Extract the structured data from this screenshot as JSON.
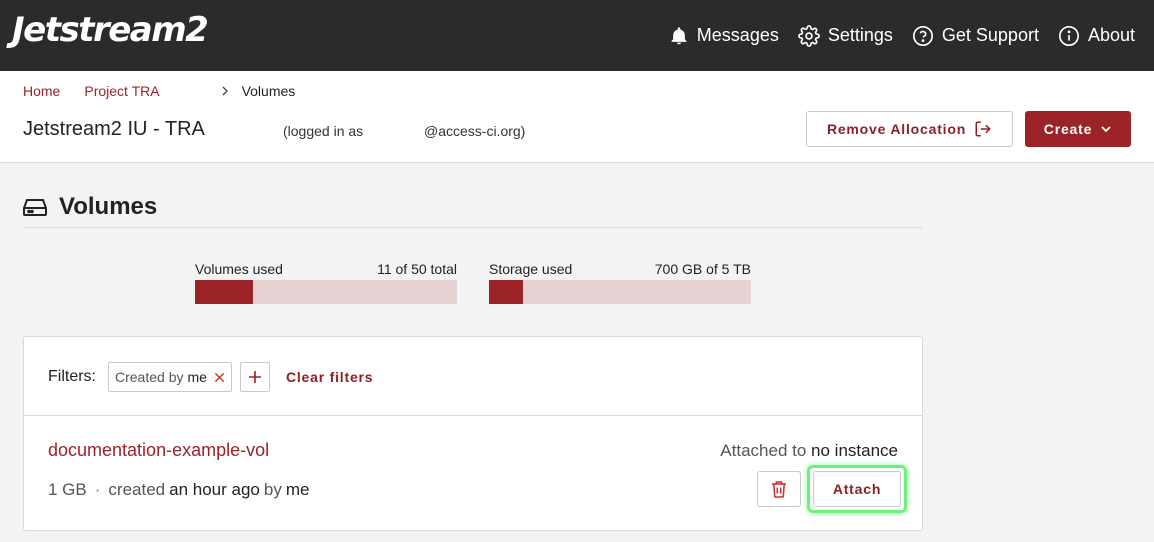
{
  "app": {
    "logo_text": "Jetstream2"
  },
  "nav": {
    "messages": "Messages",
    "settings": "Settings",
    "support": "Get Support",
    "about": "About"
  },
  "breadcrumb": {
    "home": "Home",
    "project": "Project TRA",
    "current": "Volumes"
  },
  "header": {
    "project_title": "Jetstream2 IU - TRA",
    "logged_in_prefix": "(logged in as",
    "logged_in_email": "@access-ci.org)",
    "remove_allocation": "Remove Allocation",
    "create": "Create"
  },
  "page": {
    "title": "Volumes"
  },
  "usage": {
    "volumes": {
      "label": "Volumes used",
      "value_text": "11 of 50 total",
      "fraction": 0.22
    },
    "storage": {
      "label": "Storage used",
      "value_text": "700 GB of 5 TB",
      "fraction": 0.13
    }
  },
  "filters": {
    "label": "Filters:",
    "chip_key": "Created by",
    "chip_value": "me",
    "clear": "Clear filters"
  },
  "volume": {
    "name": "documentation-example-vol",
    "size": "1 GB",
    "created_prefix": "created",
    "created_when": "an hour ago",
    "by_prefix": "by",
    "by_who": "me",
    "attached_prefix": "Attached to",
    "attached_value": "no instance",
    "attach_label": "Attach"
  },
  "colors": {
    "accent": "#9b2226",
    "topbar": "#2b2b2b",
    "highlight": "#6cf27a"
  }
}
